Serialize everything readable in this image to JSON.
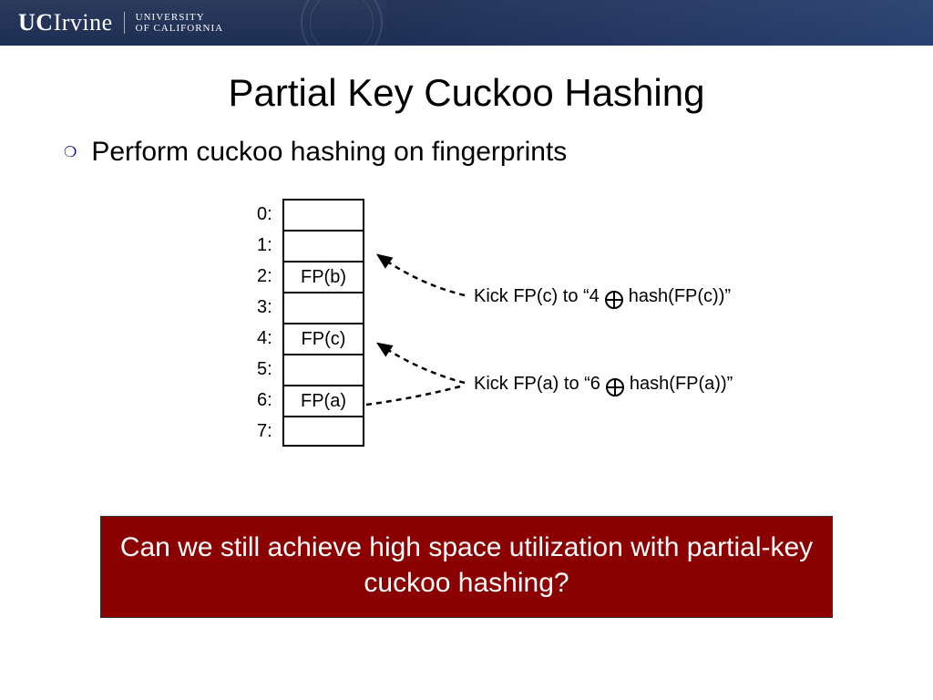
{
  "header": {
    "logo_uc": "UC",
    "logo_irvine": "Irvine",
    "uni_line1": "UNIVERSITY",
    "uni_line2": "OF CALIFORNIA"
  },
  "title": "Partial Key Cuckoo Hashing",
  "bullet": "Perform cuckoo hashing on fingerprints",
  "table": {
    "rows": [
      {
        "label": "0:",
        "value": ""
      },
      {
        "label": "1:",
        "value": ""
      },
      {
        "label": "2:",
        "value": "FP(b)"
      },
      {
        "label": "3:",
        "value": ""
      },
      {
        "label": "4:",
        "value": "FP(c)"
      },
      {
        "label": "5:",
        "value": ""
      },
      {
        "label": "6:",
        "value": "FP(a)"
      },
      {
        "label": "7:",
        "value": ""
      }
    ]
  },
  "annotations": {
    "kick_c_pre": "Kick FP(c) to “4",
    "kick_c_post": "hash(FP(c))”",
    "kick_a_pre": "Kick FP(a) to “6",
    "kick_a_post": "hash(FP(a))”"
  },
  "question": "Can we still achieve high space utilization with partial-key cuckoo hashing?"
}
